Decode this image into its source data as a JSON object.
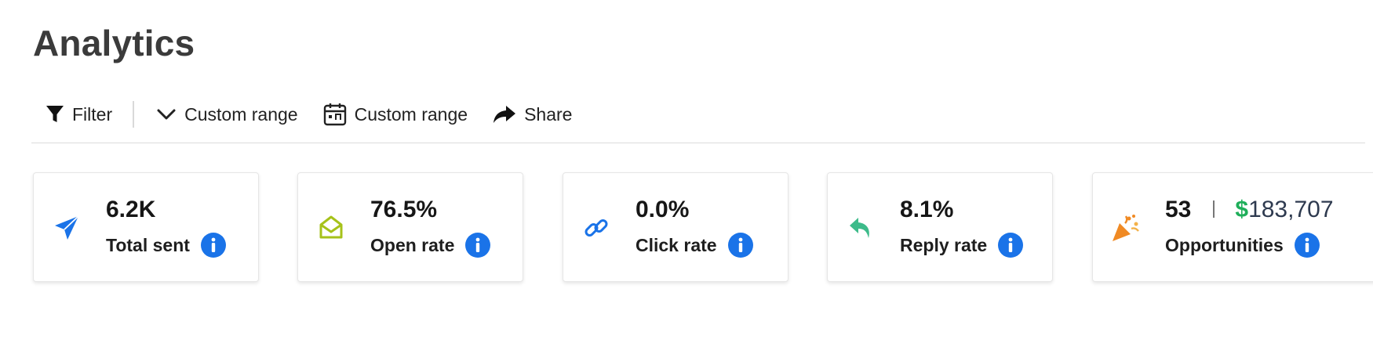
{
  "page": {
    "title": "Analytics"
  },
  "toolbar": {
    "filter_label": "Filter",
    "range_dropdown_label": "Custom range",
    "range_calendar_label": "Custom range",
    "share_label": "Share"
  },
  "cards": [
    {
      "icon": "paper-plane-icon",
      "value": "6.2K",
      "label": "Total sent",
      "icon_color": "#1a73e8"
    },
    {
      "icon": "open-envelope-icon",
      "value": "76.5%",
      "label": "Open rate",
      "icon_color": "#a6c21a"
    },
    {
      "icon": "link-icon",
      "value": "0.0%",
      "label": "Click rate",
      "icon_color": "#1a73e8"
    },
    {
      "icon": "reply-arrow-icon",
      "value": "8.1%",
      "label": "Reply rate",
      "icon_color": "#3dbb8a"
    },
    {
      "icon": "party-popper-icon",
      "value": "53",
      "money_symbol": "$",
      "money_value": "183,707",
      "label": "Opportunities",
      "icon_color": "#f08a24"
    }
  ],
  "colors": {
    "info_badge": "#1a73e8",
    "money_symbol": "#1fae5a"
  }
}
